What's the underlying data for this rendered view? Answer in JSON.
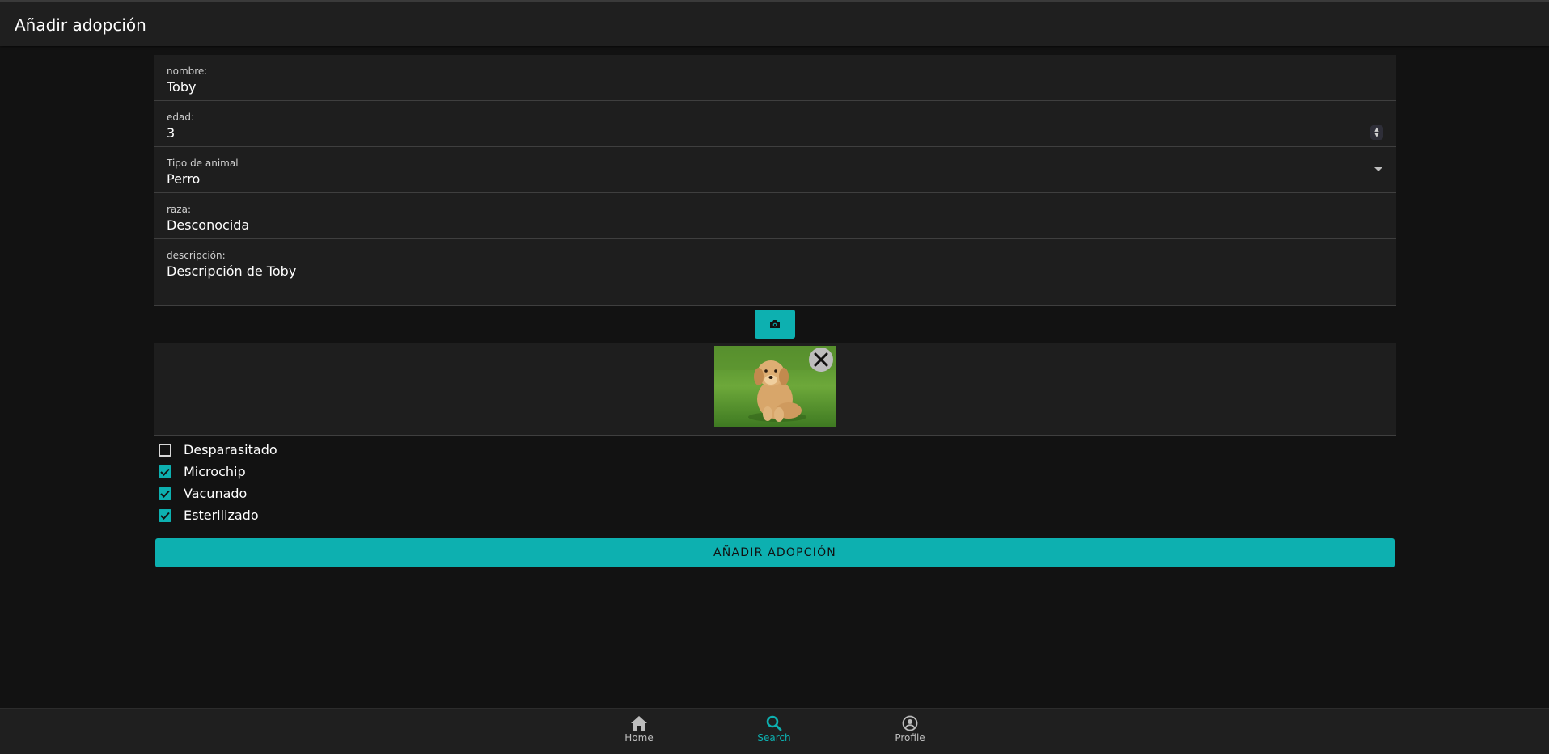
{
  "header": {
    "title": "Añadir adopción"
  },
  "form": {
    "nombre": {
      "label": "nombre:",
      "value": "Toby"
    },
    "edad": {
      "label": "edad:",
      "value": "3"
    },
    "tipo": {
      "label": "Tipo de animal",
      "value": "Perro"
    },
    "raza": {
      "label": "raza:",
      "value": "Desconocida"
    },
    "descripcion": {
      "label": "descripción:",
      "value": "Descripción de Toby"
    }
  },
  "photo": {
    "subject": "puppy-photo"
  },
  "checkboxes": [
    {
      "label": "Desparasitado",
      "checked": false
    },
    {
      "label": "Microchip",
      "checked": true
    },
    {
      "label": "Vacunado",
      "checked": true
    },
    {
      "label": "Esterilizado",
      "checked": true
    }
  ],
  "submit_label": "AÑADIR ADOPCIÓN",
  "nav": {
    "items": [
      {
        "label": "Home",
        "icon": "home-icon",
        "active": false
      },
      {
        "label": "Search",
        "icon": "search-icon",
        "active": true
      },
      {
        "label": "Profile",
        "icon": "profile-icon",
        "active": false
      }
    ]
  },
  "colors": {
    "accent": "#0db0b0",
    "background": "#121212",
    "surface": "#1e1e1e",
    "inactive_nav": "#bdbdbd"
  }
}
